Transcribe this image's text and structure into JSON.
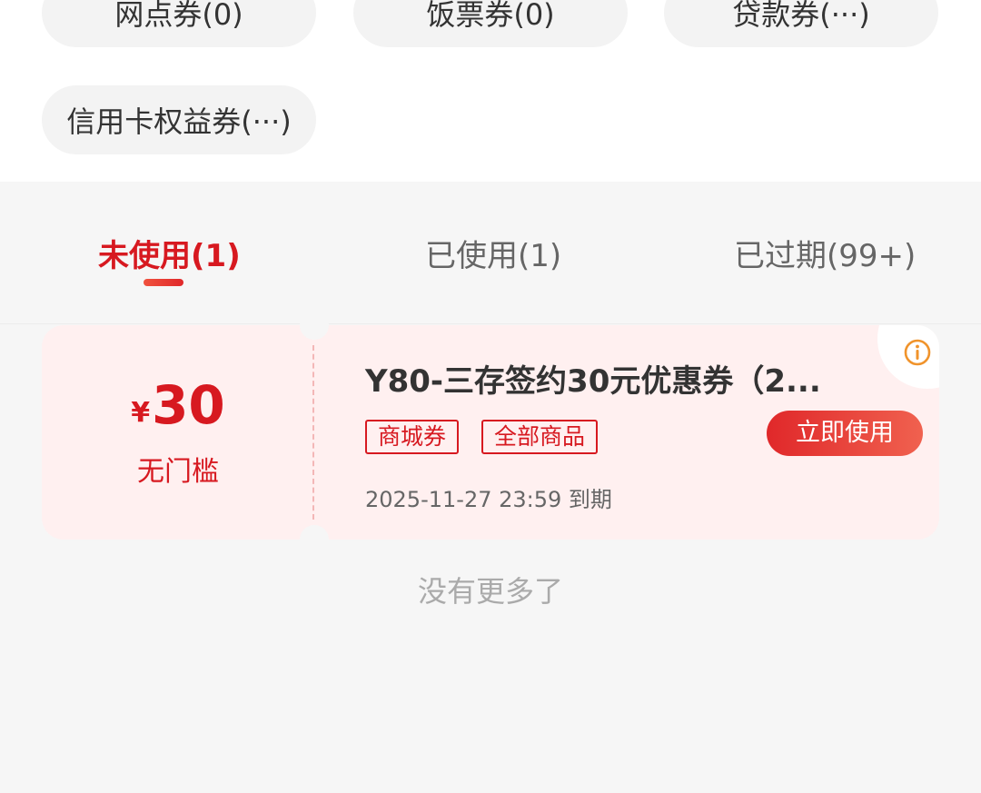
{
  "categories": [
    {
      "label": "网点券(0)"
    },
    {
      "label": "饭票券(0)"
    },
    {
      "label": "贷款券(···)"
    },
    {
      "label": "信用卡权益券(···)"
    }
  ],
  "tabs": [
    {
      "label": "未使用(1)",
      "active": true
    },
    {
      "label": "已使用(1)",
      "active": false
    },
    {
      "label": "已过期(99+)",
      "active": false
    }
  ],
  "coupon": {
    "currency": "¥",
    "amount": "30",
    "threshold": "无门槛",
    "title": "Y80-三存签约30元优惠券（2...",
    "tags": [
      "商城券",
      "全部商品"
    ],
    "expire": "2025-11-27 23:59 到期",
    "use_label": "立即使用",
    "info_icon": "info-circle-icon"
  },
  "footer": {
    "no_more": "没有更多了"
  },
  "colors": {
    "accent": "#d71920",
    "coupon_bg": "#fff0f0",
    "info_icon": "#f0932b",
    "page_bg": "#f6f6f6"
  }
}
